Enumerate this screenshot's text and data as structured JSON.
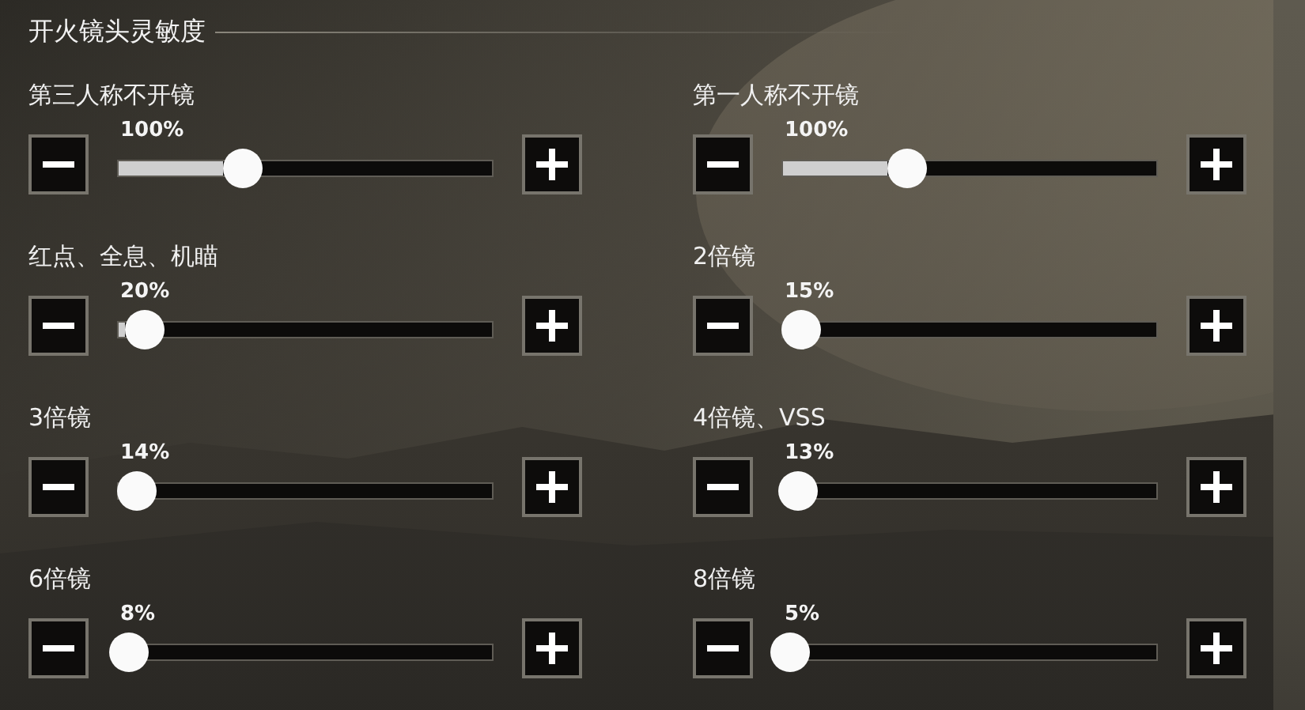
{
  "section": {
    "title": "开火镜头灵敏度"
  },
  "sliders": [
    {
      "label": "第三人称不开镜",
      "reading": "100%",
      "level": 0.33
    },
    {
      "label": "第一人称不开镜",
      "reading": "100%",
      "level": 0.33
    },
    {
      "label": "红点、全息、机瞄",
      "reading": "20%",
      "level": 0.07
    },
    {
      "label": "2倍镜",
      "reading": "15%",
      "level": 0.05
    },
    {
      "label": "3倍镜",
      "reading": "14%",
      "level": 0.05
    },
    {
      "label": "4倍镜、VSS",
      "reading": "13%",
      "level": 0.04
    },
    {
      "label": "6倍镜",
      "reading": "8%",
      "level": 0.03
    },
    {
      "label": "8倍镜",
      "reading": "5%",
      "level": 0.02
    }
  ]
}
